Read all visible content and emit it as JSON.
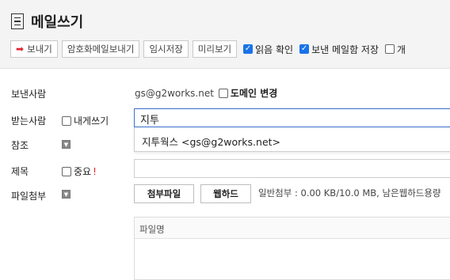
{
  "header": {
    "title": "메일쓰기",
    "icon": "document-list-icon"
  },
  "toolbar": {
    "send_label": "보내기",
    "send_icon_color": "#e0262d",
    "encrypted_send_label": "암호화메일보내기",
    "save_draft_label": "임시저장",
    "preview_label": "미리보기",
    "read_receipt_label": "읽음 확인",
    "read_receipt_checked": true,
    "save_sent_label": "보낸 메일함 저장",
    "save_sent_checked": true,
    "cut_label": "개",
    "cut_checked": false
  },
  "form": {
    "sender_label": "보낸사람",
    "sender_value": "gs@g2works.net",
    "domain_change_label": "도메인 변경",
    "to_label": "받는사람",
    "self_send_label": "내게쓰기",
    "to_value": "지투",
    "suggestion": "지투웍스 <gs@g2works.net>",
    "cc_label": "참조",
    "subject_label": "제목",
    "important_label": "중요",
    "important_icon": "!",
    "attach_label": "파일첨부",
    "attach_file_button": "첨부파일",
    "webhard_button": "웹하드",
    "attach_info": "일반첨부 : 0.00 KB/10.0 MB, 남은웹하드용량",
    "file_column_header": "파일명"
  },
  "colors": {
    "accent_blue": "#1a73e8",
    "input_focus_border": "#3b6fc9",
    "header_bg": "#f4f4f4"
  }
}
